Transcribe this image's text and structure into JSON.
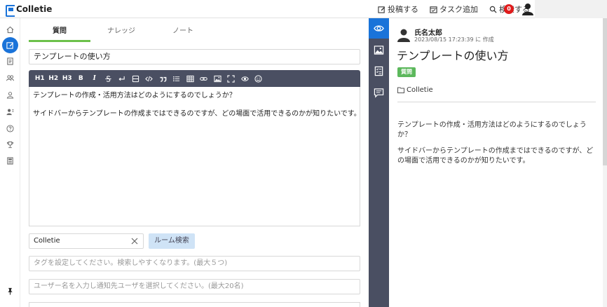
{
  "app": {
    "name": "Colletie"
  },
  "topbar": {
    "post_label": "投稿する",
    "add_task_label": "タスク追加",
    "search_label": "検索する",
    "notification_count": "0"
  },
  "editor": {
    "tabs": [
      {
        "label": "質問",
        "active": true
      },
      {
        "label": "ナレッジ",
        "active": false
      },
      {
        "label": "ノート",
        "active": false
      }
    ],
    "title_value": "テンプレートの使い方",
    "toolbar": {
      "h1": "H1",
      "h2": "H2",
      "h3": "H3",
      "bold": "B",
      "italic": "I"
    },
    "body_lines": [
      "テンプレートの作成・活用方法はどのようにするのでしょうか？",
      "サイドバーからテンプレートの作成まではできるのですが、どの場面で活用できるのかが知りたいです。"
    ],
    "room_value": "Colletie",
    "room_search_label": "ルーム検索",
    "tags_placeholder": "タグを設定してください。検索しやすくなります。(最大５つ)",
    "notify_placeholder": "ユーザー名を入力し通知先ユーザを選択してください。(最大20名)"
  },
  "preview": {
    "author": "氏名太郎",
    "date": "2023/08/15 17:23:39 に 作成",
    "title": "テンプレートの使い方",
    "badge": "質問",
    "room": "Colletie",
    "body_lines": [
      "テンプレートの作成・活用方法はどのようにするのでしょうか？",
      "サイドバーからテンプレートの作成まではできるのですが、どの場面で活用できるのかが知りたいです。"
    ]
  },
  "colors": {
    "accent": "#1a73d9",
    "tab_underline": "#6cc04a",
    "toolbar_bg": "#4a4f62",
    "badge_green": "#5cb85c",
    "notification_red": "#e01c1c"
  }
}
